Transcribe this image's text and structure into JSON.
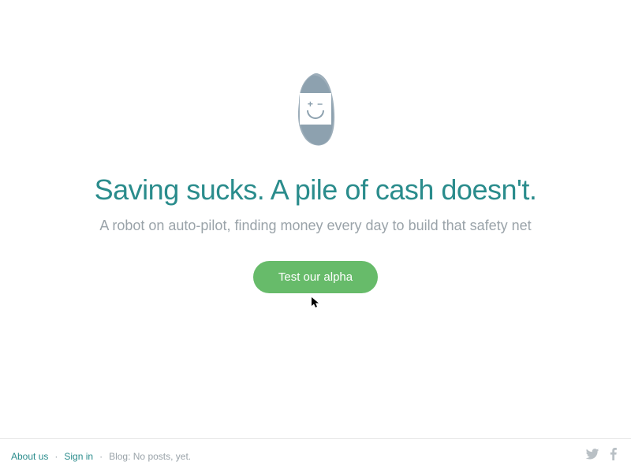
{
  "hero": {
    "headline": "Saving sucks. A pile of cash doesn't.",
    "subhead": "A robot on auto-pilot, finding money every day to build that safety net",
    "cta_label": "Test our alpha",
    "logo_icon": "plus-minus-smile"
  },
  "footer": {
    "about_label": "About us",
    "signin_label": "Sign in",
    "blog_text": "Blog: No posts, yet.",
    "separator": "·"
  },
  "colors": {
    "teal": "#2a8c8c",
    "green": "#67bb6a",
    "muted": "#9aa3a9",
    "smudge": "#8ca0ae"
  }
}
